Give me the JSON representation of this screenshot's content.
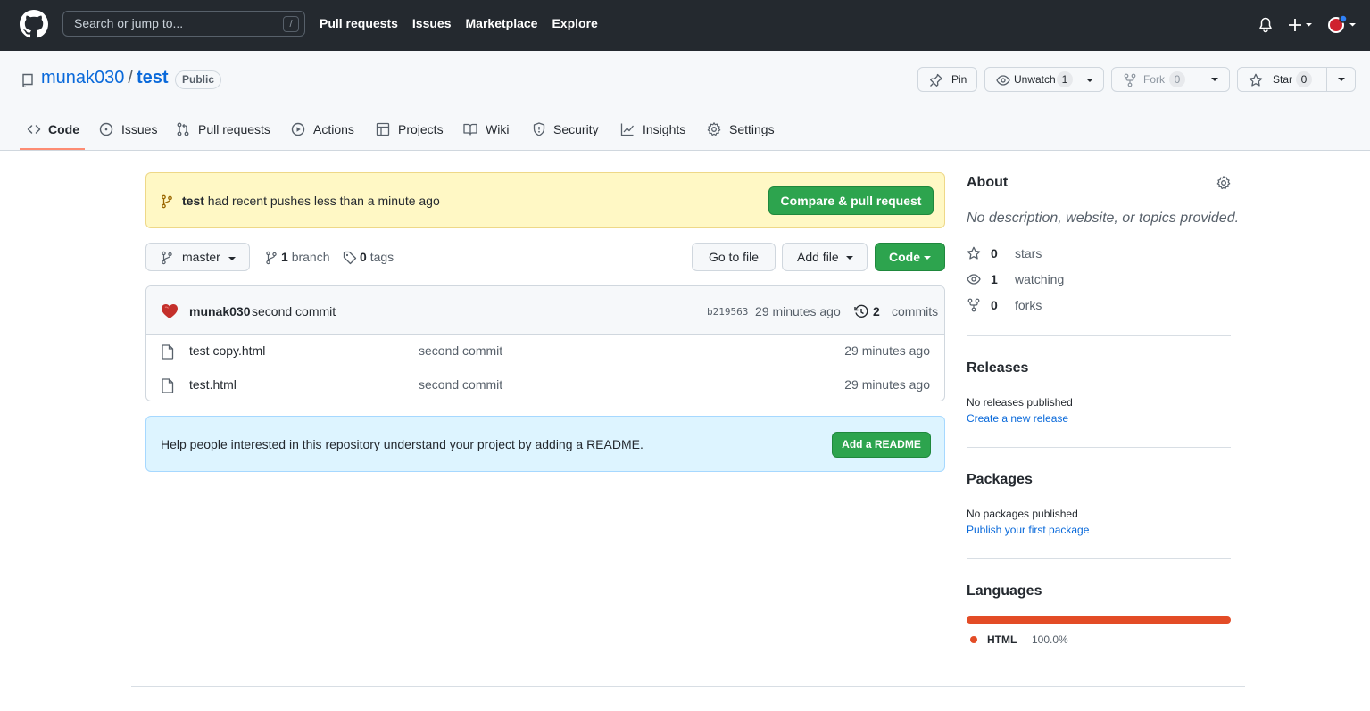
{
  "header": {
    "search_placeholder": "Search or jump to...",
    "search_shortcut": "/",
    "nav": [
      "Pull requests",
      "Issues",
      "Marketplace",
      "Explore"
    ]
  },
  "repo": {
    "owner": "munak030",
    "separator": "/",
    "name": "test",
    "visibility": "Public",
    "pin_label": "Pin",
    "unwatch_label": "Unwatch",
    "watch_count": "1",
    "fork_label": "Fork",
    "fork_count": "0",
    "star_label": "Star",
    "star_count": "0"
  },
  "tabs": [
    {
      "label": "Code",
      "icon": "code-icon",
      "active": true
    },
    {
      "label": "Issues",
      "icon": "issue-opened-icon"
    },
    {
      "label": "Pull requests",
      "icon": "git-pull-request-icon"
    },
    {
      "label": "Actions",
      "icon": "play-icon"
    },
    {
      "label": "Projects",
      "icon": "table-icon"
    },
    {
      "label": "Wiki",
      "icon": "book-icon"
    },
    {
      "label": "Security",
      "icon": "shield-icon"
    },
    {
      "label": "Insights",
      "icon": "graph-icon"
    },
    {
      "label": "Settings",
      "icon": "gear-icon"
    }
  ],
  "flash": {
    "branch": "test",
    "message": "had recent pushes less than a minute ago",
    "button": "Compare & pull request"
  },
  "filenav": {
    "branch": "master",
    "branch_count": "1",
    "branch_label": "branch",
    "tag_count": "0",
    "tag_label": "tags",
    "go_to_file": "Go to file",
    "add_file": "Add file",
    "code": "Code"
  },
  "latest_commit": {
    "author": "munak030",
    "message": "second commit",
    "sha": "b219563",
    "time": "29 minutes ago",
    "count": "2",
    "count_label": "commits"
  },
  "files": [
    {
      "name": "test copy.html",
      "message": "second commit",
      "time": "29 minutes ago"
    },
    {
      "name": "test.html",
      "message": "second commit",
      "time": "29 minutes ago"
    }
  ],
  "readme_prompt": {
    "text": "Help people interested in this repository understand your project by adding a README.",
    "button": "Add a README"
  },
  "sidebar": {
    "about_title": "About",
    "about_desc": "No description, website, or topics provided.",
    "stars": {
      "count": "0",
      "label": "stars"
    },
    "watching": {
      "count": "1",
      "label": "watching"
    },
    "forks": {
      "count": "0",
      "label": "forks"
    },
    "releases_title": "Releases",
    "releases_text": "No releases published",
    "releases_link": "Create a new release",
    "packages_title": "Packages",
    "packages_text": "No packages published",
    "packages_link": "Publish your first package",
    "languages_title": "Languages",
    "languages": [
      {
        "name": "HTML",
        "percent": "100.0%",
        "color": "#e34c26"
      }
    ]
  },
  "colors": {
    "header_bg": "#24292f",
    "accent_green": "#2da44e",
    "link_blue": "#0969da",
    "tab_underline": "#fd8c73"
  }
}
